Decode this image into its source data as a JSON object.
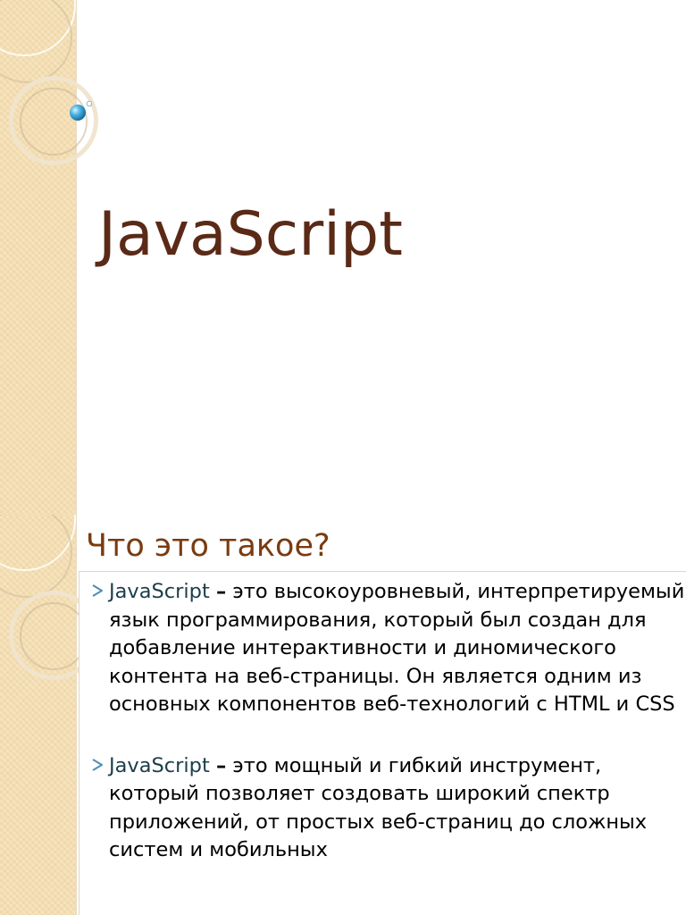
{
  "title_slide": {
    "title": "JavaScript"
  },
  "content_slide": {
    "heading": "Что это такое?",
    "bullets": [
      {
        "term": "JavaScript",
        "dash": "–",
        "text": "это высокоуровневый, интерпретируемый язык программирования, который был создан для добавление интерактивности и диномического контента на веб-страницы. Он является одним из основных компонентов веб-технологий с HTML и CSS"
      },
      {
        "term": "JavaScript",
        "dash": "–",
        "text": "это мощный и гибкий инструмент, который позволяет создовать широкий спектр приложений, от простых веб-страниц до сложных систем и мобильных"
      }
    ]
  },
  "colors": {
    "title": "#5a2a17",
    "heading": "#7a3b10",
    "term": "#1c3e4a",
    "band": "#f3ddb0",
    "bullet_marker": "#4a8fb5"
  },
  "icons": {
    "bullet": "arrow-bullet-icon",
    "decoration": "ring-decoration-icon"
  }
}
